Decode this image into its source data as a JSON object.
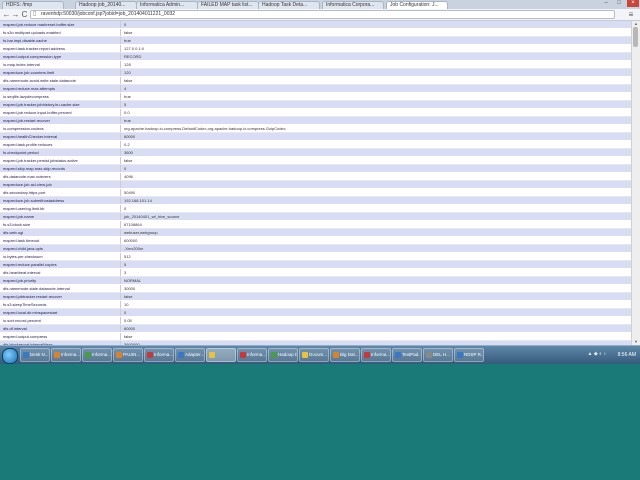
{
  "tabs": [
    {
      "label": "HDFS: /tmp",
      "active": false
    },
    {
      "label": "Hadoop job_20140...",
      "active": false
    },
    {
      "label": "Informatica Admin...",
      "active": false
    },
    {
      "label": "FAILED MAP task list...",
      "active": false
    },
    {
      "label": "Hadoop Task Deta...",
      "active": false
    },
    {
      "label": "Informatica Corpora...",
      "active": false
    },
    {
      "label": "Job Configuration: J...",
      "active": true
    }
  ],
  "window_controls": {
    "minimize": "–",
    "maximize": "□",
    "close": "×"
  },
  "toolbar": {
    "back": "←",
    "forward": "→",
    "reload": "C",
    "url": "ravenhdp:50030/jobconf.jsp?jobid=job_201404011221_0032",
    "menu": "≡"
  },
  "config_rows": [
    [
      "mapred.job.reduce.markreset.buffer.size",
      "0"
    ],
    [
      "fs.s3n.multipart.uploads.enabled",
      "false"
    ],
    [
      "fs.har.impl.disable.cache",
      "true"
    ],
    [
      "mapred.task.tracker.report.address",
      "127.0.0.1:0"
    ],
    [
      "mapred.output.compression.type",
      "RECORD"
    ],
    [
      "io.map.index.interval",
      "128"
    ],
    [
      "mapreduce.job.counters.limit",
      "120"
    ],
    [
      "dfs.namenode.avoid.write.stale.datanode",
      "false"
    ],
    [
      "mapred.reduce.max.attempts",
      "4"
    ],
    [
      "io.seqfile.lazydecompress",
      "true"
    ],
    [
      "mapred.job.tracker.jobhistory.lru.cache.size",
      "5"
    ],
    [
      "mapred.job.reduce.input.buffer.percent",
      "0.0"
    ],
    [
      "mapred.job.restart.recover",
      "true"
    ],
    [
      "io.compression.codecs",
      "org.apache.hadoop.io.compress.DefaultCodec,org.apache.hadoop.io.compress.GzipCodec"
    ],
    [
      "mapred.healthChecker.interval",
      "60000"
    ],
    [
      "mapred.task.profile.reduces",
      "0-2"
    ],
    [
      "fs.checkpoint.period",
      "3600"
    ],
    [
      "mapred.job.tracker.persist.jobstatus.active",
      "false"
    ],
    [
      "mapred.skip.map.max.skip.records",
      "0"
    ],
    [
      "dfs.datanode.max.xcievers",
      "4096"
    ],
    [
      "mapreduce.job.acl-view-job",
      ""
    ],
    [
      "dfs.secondary.https.port",
      "50490"
    ],
    [
      "mapreduce.job.submithostaddress",
      "192.168.101.14"
    ],
    [
      "mapred.userlog.limit.kb",
      "0"
    ],
    [
      "mapred.job.name",
      "job_20140401_wf_hive_source"
    ],
    [
      "fs.s3.block.size",
      "67108864"
    ],
    [
      "dfs.web.ugi",
      "webuser,webgroup"
    ],
    [
      "mapred.task.timeout",
      "600000"
    ],
    [
      "mapred.child.java.opts",
      "-Xmx200m"
    ],
    [
      "io.bytes.per.checksum",
      "512"
    ],
    [
      "mapred.reduce.parallel.copies",
      "5"
    ],
    [
      "dfs.heartbeat.interval",
      "3"
    ],
    [
      "mapred.job.priority",
      "NORMAL"
    ],
    [
      "dfs.namenode.stale.datanode.interval",
      "30000"
    ],
    [
      "mapred.jobtracker.restart.recover",
      "false"
    ],
    [
      "fs.s3.sleepTimeSeconds",
      "10"
    ],
    [
      "mapred.local.dir.minspacestart",
      "0"
    ],
    [
      "io.sort.record.percent",
      "0.05"
    ],
    [
      "dfs.df.interval",
      "60000"
    ],
    [
      "mapred.output.compress",
      "false"
    ],
    [
      "dfs.blockreport.intervalMsec",
      "3600000"
    ],
    [
      "mapred.tasktracker.dns.nameserver",
      "default"
    ],
    [
      "mapred.submit.replication",
      "10"
    ],
    [
      "mapred.job.tracker.handler.count",
      "10"
    ],
    [
      "dfs.block.access.token.enable",
      "false"
    ]
  ],
  "taskbar": {
    "items": [
      {
        "label": "Desk N...",
        "color": "#3a78c4",
        "active": false
      },
      {
        "label": "Informa...",
        "color": "#d9822b",
        "active": false
      },
      {
        "label": "Informa...",
        "color": "#4a9a4a",
        "active": false
      },
      {
        "label": "PAUIN...",
        "color": "#d9822b",
        "active": false
      },
      {
        "label": "Informa...",
        "color": "#c43a3a",
        "active": false
      },
      {
        "label": "Adapter...",
        "color": "#3a78c4",
        "active": false
      },
      {
        "label": "",
        "color": "#e8c23a",
        "active": true
      },
      {
        "label": "Informa...",
        "color": "#c43a3a",
        "active": false
      },
      {
        "label": "Hadoop Dete...",
        "color": "#4a9a4a",
        "active": false
      },
      {
        "label": "Docum...",
        "color": "#e8c23a",
        "active": false
      },
      {
        "label": "Big Dat...",
        "color": "#d9822b",
        "active": false
      },
      {
        "label": "Informa...",
        "color": "#c43a3a",
        "active": false
      },
      {
        "label": "TextPad...",
        "color": "#3a78c4",
        "active": false
      },
      {
        "label": "DEL H...",
        "color": "#888888",
        "active": false
      },
      {
        "label": "RDSP R...",
        "color": "#3a78c4",
        "active": false
      }
    ],
    "tray_icons": "▲ ◆ ◐ ♪",
    "clock": "8:56 AM"
  }
}
